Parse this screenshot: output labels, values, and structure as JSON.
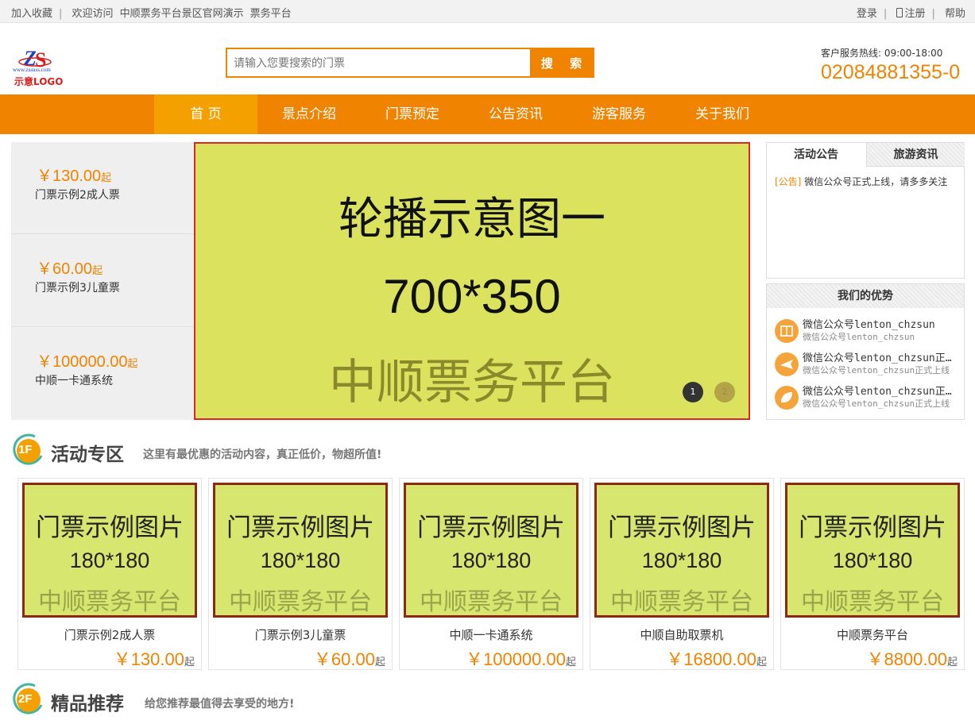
{
  "topbar": {
    "bookmark": "加入收藏",
    "welcome": "欢迎访问",
    "site_name": "中顺票务平台景区官网演示",
    "platform_link": "票务平台",
    "login": "登录",
    "register": "注册",
    "help": "帮助"
  },
  "logo": {
    "url_text": "www.zssuss.com",
    "caption": "示意LOGO"
  },
  "search": {
    "placeholder": "请输入您要搜索的门票",
    "button": "搜 索"
  },
  "hotline": {
    "label": "客户服务热线: 09:00-18:00",
    "number": "02084881355-0"
  },
  "nav": {
    "items": [
      {
        "label": "首 页",
        "active": true
      },
      {
        "label": "景点介绍",
        "active": false
      },
      {
        "label": "门票预定",
        "active": false
      },
      {
        "label": "公告资讯",
        "active": false
      },
      {
        "label": "游客服务",
        "active": false
      },
      {
        "label": "关于我们",
        "active": false
      }
    ]
  },
  "side_tickets": [
    {
      "price": "￥130.00",
      "suffix": "起",
      "name": "门票示例2成人票"
    },
    {
      "price": "￥60.00",
      "suffix": "起",
      "name": "门票示例3儿童票"
    },
    {
      "price": "￥100000.00",
      "suffix": "起",
      "name": "中顺一卡通系统"
    }
  ],
  "carousel": {
    "line1": "轮播示意图一",
    "line2": "700*350",
    "line3": "中顺票务平台",
    "dots": [
      "1",
      "2"
    ],
    "active_dot": 1
  },
  "notice": {
    "tab_active": "活动公告",
    "tab_other": "旅游资讯",
    "items": [
      {
        "tag": "[公告]",
        "text": "微信公众号正式上线，请多多关注"
      }
    ]
  },
  "advantages": {
    "title": "我们的优势",
    "items": [
      {
        "icon": "book-icon",
        "title": "微信公众号lenton_chzsun",
        "sub": "微信公众号lenton_chzsun"
      },
      {
        "icon": "plane-icon",
        "title": "微信公众号lenton_chzsun正式上线",
        "sub": "微信公众号lenton_chzsun正式上线"
      },
      {
        "icon": "leaf-icon",
        "title": "微信公众号lenton_chzsun正式上线",
        "sub": "微信公众号lenton_chzsun正式上线"
      }
    ]
  },
  "floor1": {
    "badge": "1F",
    "title": "活动专区",
    "subtitle": "这里有最优惠的活动内容，真正低价，物超所值!"
  },
  "floor2": {
    "badge": "2F",
    "title": "精品推荐",
    "subtitle": "给您推荐最值得去享受的地方!"
  },
  "product_image": {
    "line1": "门票示例图片",
    "line2": "180*180",
    "line3": "中顺票务平台"
  },
  "products": [
    {
      "name": "门票示例2成人票",
      "price": "￥130.00",
      "suffix": "起"
    },
    {
      "name": "门票示例3儿童票",
      "price": "￥60.00",
      "suffix": "起"
    },
    {
      "name": "中顺一卡通系统",
      "price": "￥100000.00",
      "suffix": "起"
    },
    {
      "name": "中顺自助取票机",
      "price": "￥16800.00",
      "suffix": "起"
    },
    {
      "name": "中顺票务平台",
      "price": "￥8800.00",
      "suffix": "起"
    }
  ],
  "colors": {
    "accent": "#f08300",
    "nav_active": "#f4a000",
    "banner_bg": "#dbe35e",
    "card_bg": "#d6e66f",
    "floor_green": "#3fb6a0"
  }
}
